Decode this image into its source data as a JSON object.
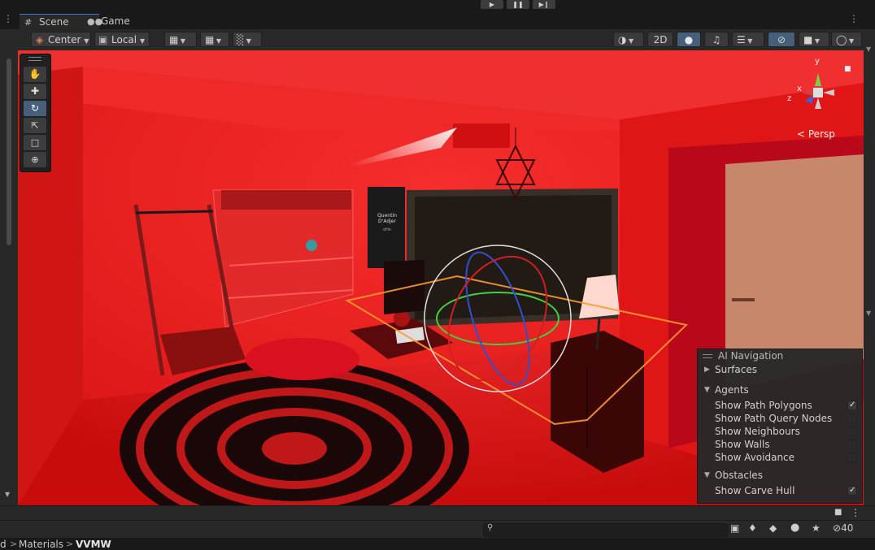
{
  "playbar": {
    "play_icon": "play-icon",
    "pause_icon": "pause-icon",
    "step_icon": "step-icon"
  },
  "tabs": [
    {
      "label": "Scene",
      "icon": "grid-icon"
    },
    {
      "label": "Game",
      "icon": "gamepad-icon"
    }
  ],
  "toolbar": {
    "pivot_label": "Center",
    "space_label": "Local",
    "mode_2d_label": "2D"
  },
  "viewport": {
    "persp_label": "Persp",
    "gizmo_axes": {
      "x": "x",
      "y": "y",
      "z": "z"
    }
  },
  "ai_navigation": {
    "title": "AI Navigation",
    "surfaces_label": "Surfaces",
    "agents_label": "Agents",
    "agent_options": [
      {
        "label": "Show Path Polygons",
        "checked": true
      },
      {
        "label": "Show Path Query Nodes",
        "checked": false
      },
      {
        "label": "Show Neighbours",
        "checked": false
      },
      {
        "label": "Show Walls",
        "checked": false
      },
      {
        "label": "Show Avoidance",
        "checked": false
      }
    ],
    "obstacles_label": "Obstacles",
    "obstacle_options": [
      {
        "label": "Show Carve Hull",
        "checked": true
      }
    ]
  },
  "scene_text": {
    "poster_line1": "Quentin D'Adjer",
    "poster_line2": "oHx"
  },
  "project": {
    "search_placeholder": "",
    "hidden_count": "40"
  },
  "breadcrumb": {
    "items": [
      "d",
      "Materials",
      "VVMW"
    ]
  },
  "colors": {
    "scene_red": "#e81a1a",
    "accent_blue": "#3a7ad0",
    "panel": "#282828"
  }
}
